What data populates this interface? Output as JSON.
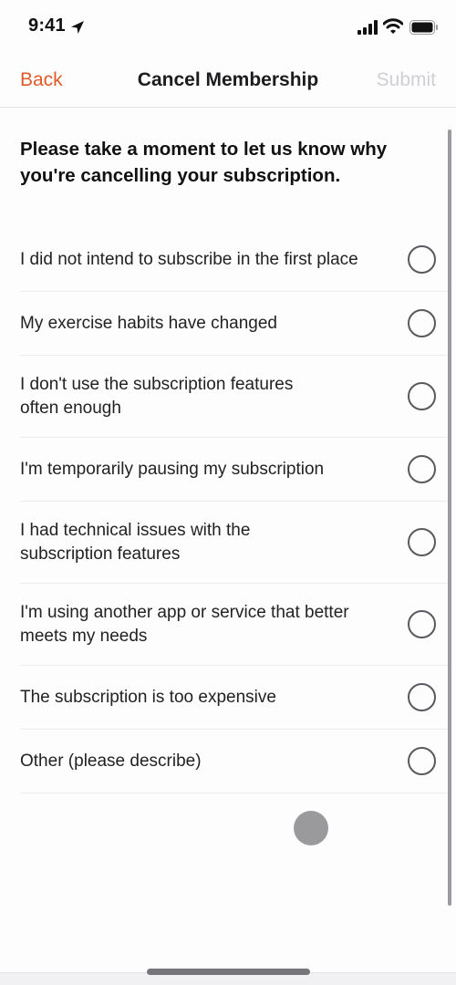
{
  "status_bar": {
    "time": "9:41",
    "icons": [
      "location-arrow-icon",
      "cellular-signal-icon",
      "wifi-icon",
      "battery-icon"
    ]
  },
  "nav": {
    "back_label": "Back",
    "title": "Cancel Membership",
    "submit_label": "Submit",
    "colors": {
      "back": "#e0592a",
      "submit_disabled": "#cfcfd4"
    }
  },
  "prompt": "Please take a moment to let us know why you're cancelling your subscription.",
  "options": [
    {
      "label": "I did not intend to subscribe in the first place",
      "selected": false
    },
    {
      "label": "My exercise habits have changed",
      "selected": false
    },
    {
      "label": "I don't use the subscription features often enough",
      "selected": false
    },
    {
      "label": "I'm temporarily pausing my subscription",
      "selected": false
    },
    {
      "label": "I had technical issues with the subscription features",
      "selected": false
    },
    {
      "label": "I'm using another app or service that better meets my needs",
      "selected": false
    },
    {
      "label": "The subscription is too expensive",
      "selected": false
    },
    {
      "label": "Other (please describe)",
      "selected": false
    }
  ]
}
